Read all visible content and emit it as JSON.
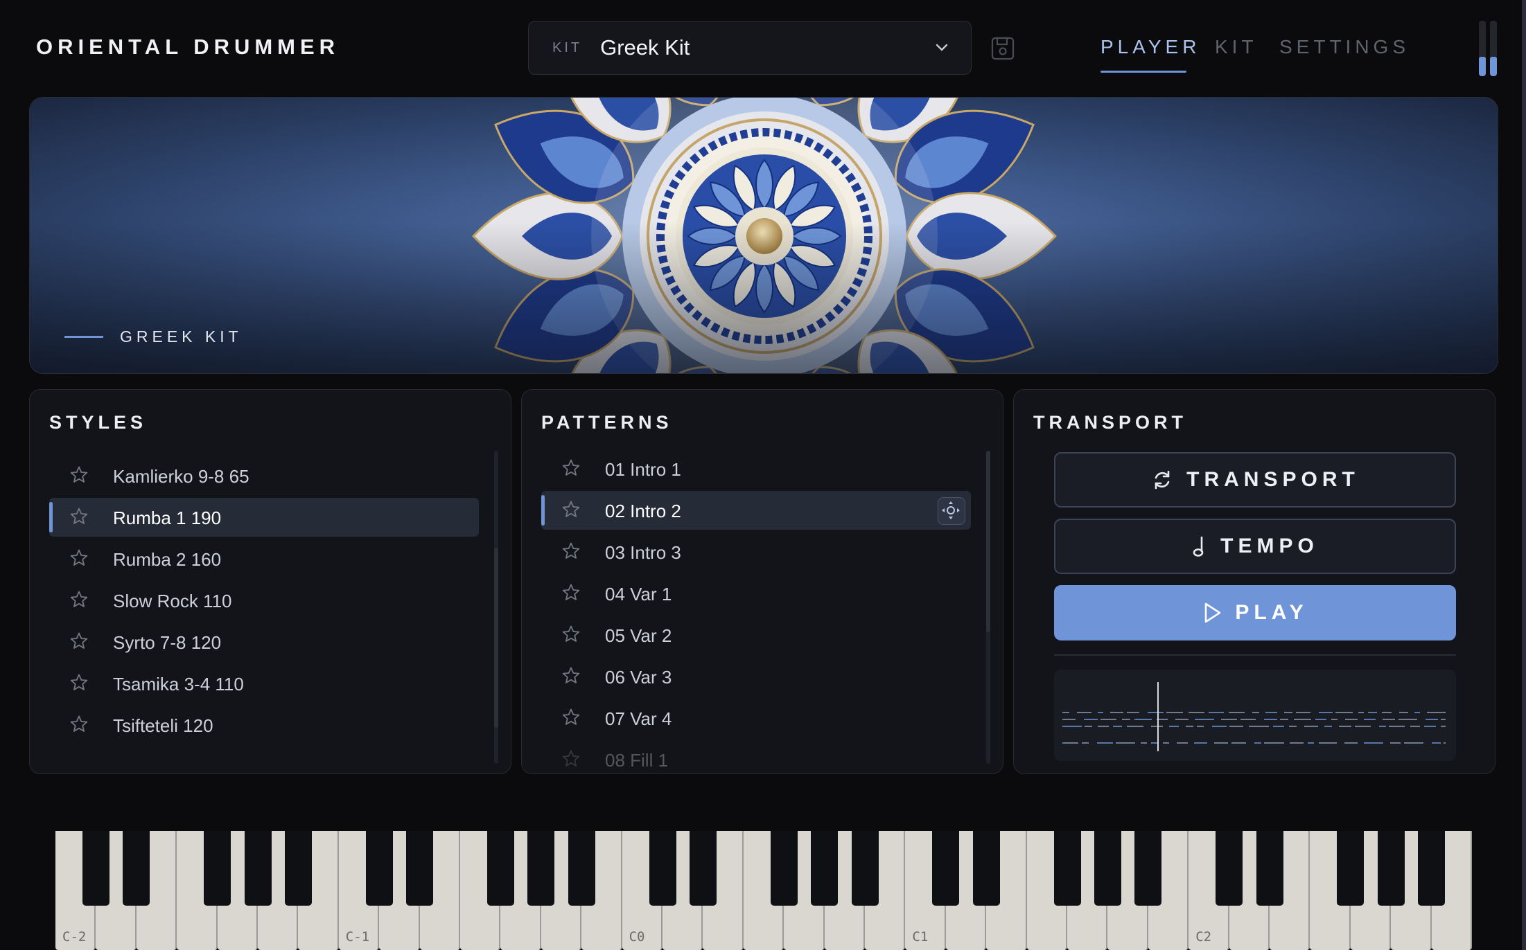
{
  "app": {
    "title": "ORIENTAL DRUMMER"
  },
  "header": {
    "kit_tag": "KIT",
    "kit_value": "Greek Kit",
    "tabs": [
      {
        "label": "PLAYER",
        "active": true
      },
      {
        "label": "KIT",
        "active": false
      },
      {
        "label": "SETTINGS",
        "active": false
      }
    ],
    "meters": {
      "left_level": 0.35,
      "right_level": 0.35
    }
  },
  "banner": {
    "label": "GREEK KIT"
  },
  "styles": {
    "title": "STYLES",
    "items": [
      {
        "label": "Kamlierko 9-8 65"
      },
      {
        "label": "Rumba 1 190",
        "selected": true
      },
      {
        "label": "Rumba 2 160"
      },
      {
        "label": "Slow Rock 110"
      },
      {
        "label": "Syrto 7-8 120"
      },
      {
        "label": "Tsamika 3-4 110"
      },
      {
        "label": "Tsifteteli 120"
      }
    ]
  },
  "patterns": {
    "title": "PATTERNS",
    "items": [
      {
        "label": "01 Intro 1"
      },
      {
        "label": "02 Intro 2",
        "selected": true
      },
      {
        "label": "03 Intro 3"
      },
      {
        "label": "04 Var 1"
      },
      {
        "label": "05 Var 2"
      },
      {
        "label": "06 Var 3"
      },
      {
        "label": "07 Var 4"
      },
      {
        "label": "08 Fill 1"
      }
    ]
  },
  "transport": {
    "title": "TRANSPORT",
    "transport_label": "TRANSPORT",
    "tempo_label": "TEMPO",
    "play_label": "PLAY"
  },
  "keyboard": {
    "octave_labels": [
      "C-2",
      "C-1",
      "C0",
      "C1",
      "C2"
    ]
  },
  "colors": {
    "accent": "#6f95d8",
    "background": "#0b0b0d",
    "panel": "#131419",
    "selected_row": "#262b38"
  },
  "icons": {
    "star": "star-icon",
    "chevron": "chevron-down-icon",
    "save": "save-icon",
    "loop": "loop-icon",
    "note": "note-icon",
    "play": "play-icon",
    "drag": "drag-icon"
  }
}
